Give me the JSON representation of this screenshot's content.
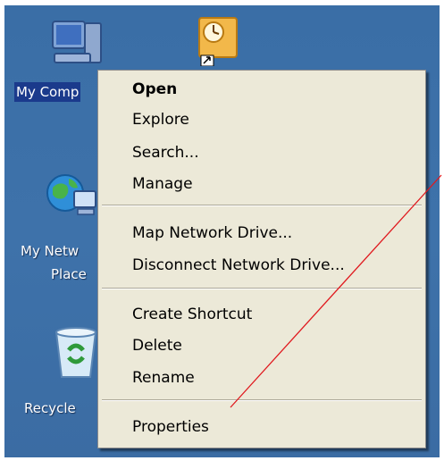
{
  "desktop": {
    "icons": [
      {
        "name": "my-computer",
        "label": "My Comp"
      },
      {
        "name": "my-network-places",
        "label_line1": "My Netw",
        "label_line2": "Place"
      },
      {
        "name": "recycle-bin",
        "label": "Recycle"
      },
      {
        "name": "shortcut",
        "label": ""
      }
    ]
  },
  "context_menu": {
    "items": [
      {
        "label": "Open",
        "bold": true
      },
      {
        "label": "Explore"
      },
      {
        "label": "Search..."
      },
      {
        "label": "Manage"
      },
      {
        "label": "Map Network Drive..."
      },
      {
        "label": "Disconnect Network Drive..."
      },
      {
        "label": "Create Shortcut"
      },
      {
        "label": "Delete"
      },
      {
        "label": "Rename"
      },
      {
        "label": "Properties"
      }
    ]
  },
  "colors": {
    "desktop": "#3b6ea5",
    "menu_bg": "#ece9d8",
    "selection": "#1b3a8c",
    "annotation_line": "#e0191e"
  }
}
